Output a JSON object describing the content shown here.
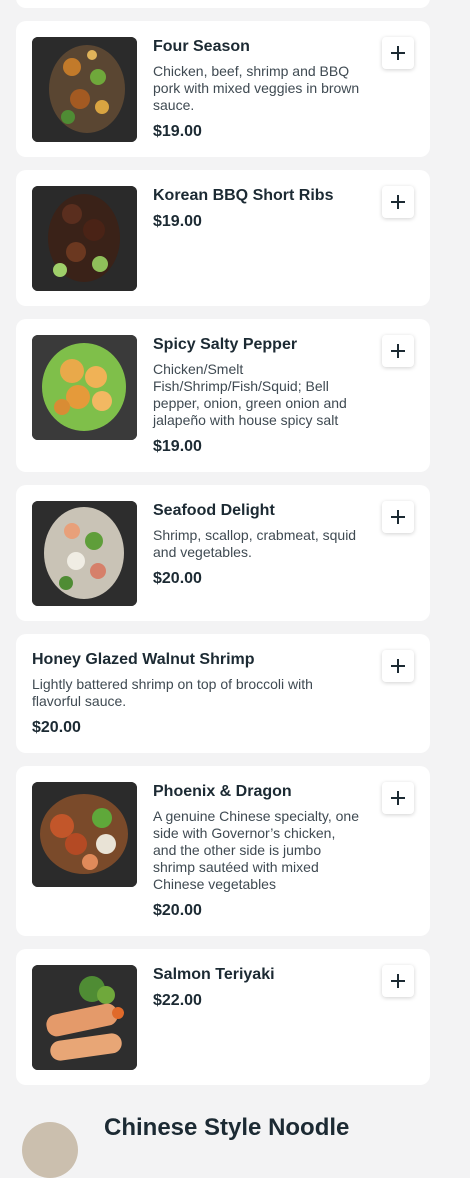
{
  "menu_items": [
    {
      "name": "Four Season",
      "description": "Chicken, beef, shrimp and BBQ pork with mixed veggies in brown sauce.",
      "price": "$19.00",
      "image_icon": "food-photo-icon"
    },
    {
      "name": "Korean BBQ Short Ribs",
      "description": "",
      "price": "$19.00",
      "image_icon": "food-photo-icon"
    },
    {
      "name": "Spicy Salty Pepper",
      "description": "Chicken/Smelt Fish/Shrimp/Fish/Squid; Bell pepper, onion, green onion and jalapeño with house spicy salt",
      "price": "$19.00",
      "image_icon": "food-photo-icon"
    },
    {
      "name": "Seafood Delight",
      "description": "Shrimp, scallop, crabmeat, squid and vegetables.",
      "price": "$20.00",
      "image_icon": "food-photo-icon"
    },
    {
      "name": "Honey Glazed Walnut Shrimp",
      "description": "Lightly battered shrimp on top of broccoli with flavorful sauce.",
      "price": "$20.00"
    },
    {
      "name": "Phoenix & Dragon",
      "description": "A genuine Chinese specialty, one side with Governor’s chicken, and the other side is jumbo shrimp sautéed with mixed Chinese vegetables",
      "price": "$20.00",
      "image_icon": "food-photo-icon"
    },
    {
      "name": "Salmon Teriyaki",
      "description": "",
      "price": "$22.00",
      "image_icon": "food-photo-icon"
    }
  ],
  "add_button_icon": "plus-icon",
  "next_section": {
    "title": "Chinese Style Noodle"
  },
  "colors": {
    "background": "#f3f3f4",
    "card": "#ffffff",
    "text": "#1c2a33",
    "muted_text": "#3f4a52"
  }
}
